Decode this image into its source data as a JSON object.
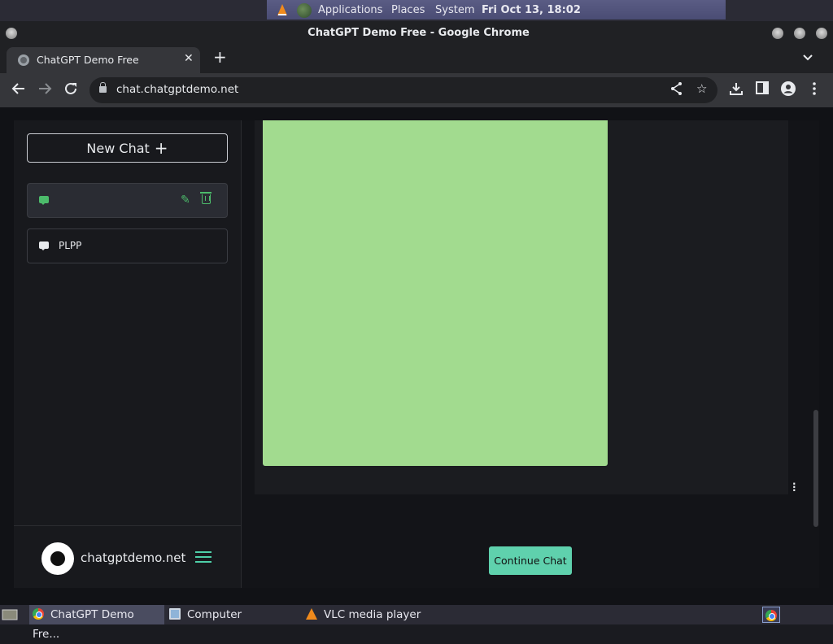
{
  "top_panel": {
    "menus": [
      "Applications",
      "Places",
      "System"
    ],
    "clock": "Fri Oct 13, 18:02"
  },
  "window": {
    "title": "ChatGPT Demo Free - Google Chrome"
  },
  "browser": {
    "tab_title": "ChatGPT Demo Free",
    "url": "chat.chatgptdemo.net"
  },
  "sidebar": {
    "new_chat_label": "New Chat",
    "chats": [
      {
        "label": "",
        "active": true
      },
      {
        "label": "PLPP",
        "active": false
      }
    ],
    "brand": "chatgptdemo.net"
  },
  "main": {
    "continue_label": "Continue Chat",
    "image_color": "#a2db8f"
  },
  "taskbar": {
    "items": [
      "ChatGPT Demo Fre...",
      "Computer",
      "VLC media player"
    ]
  },
  "colors": {
    "accent": "#5fd1ad",
    "chat_icon_active": "#4cbb6b"
  }
}
